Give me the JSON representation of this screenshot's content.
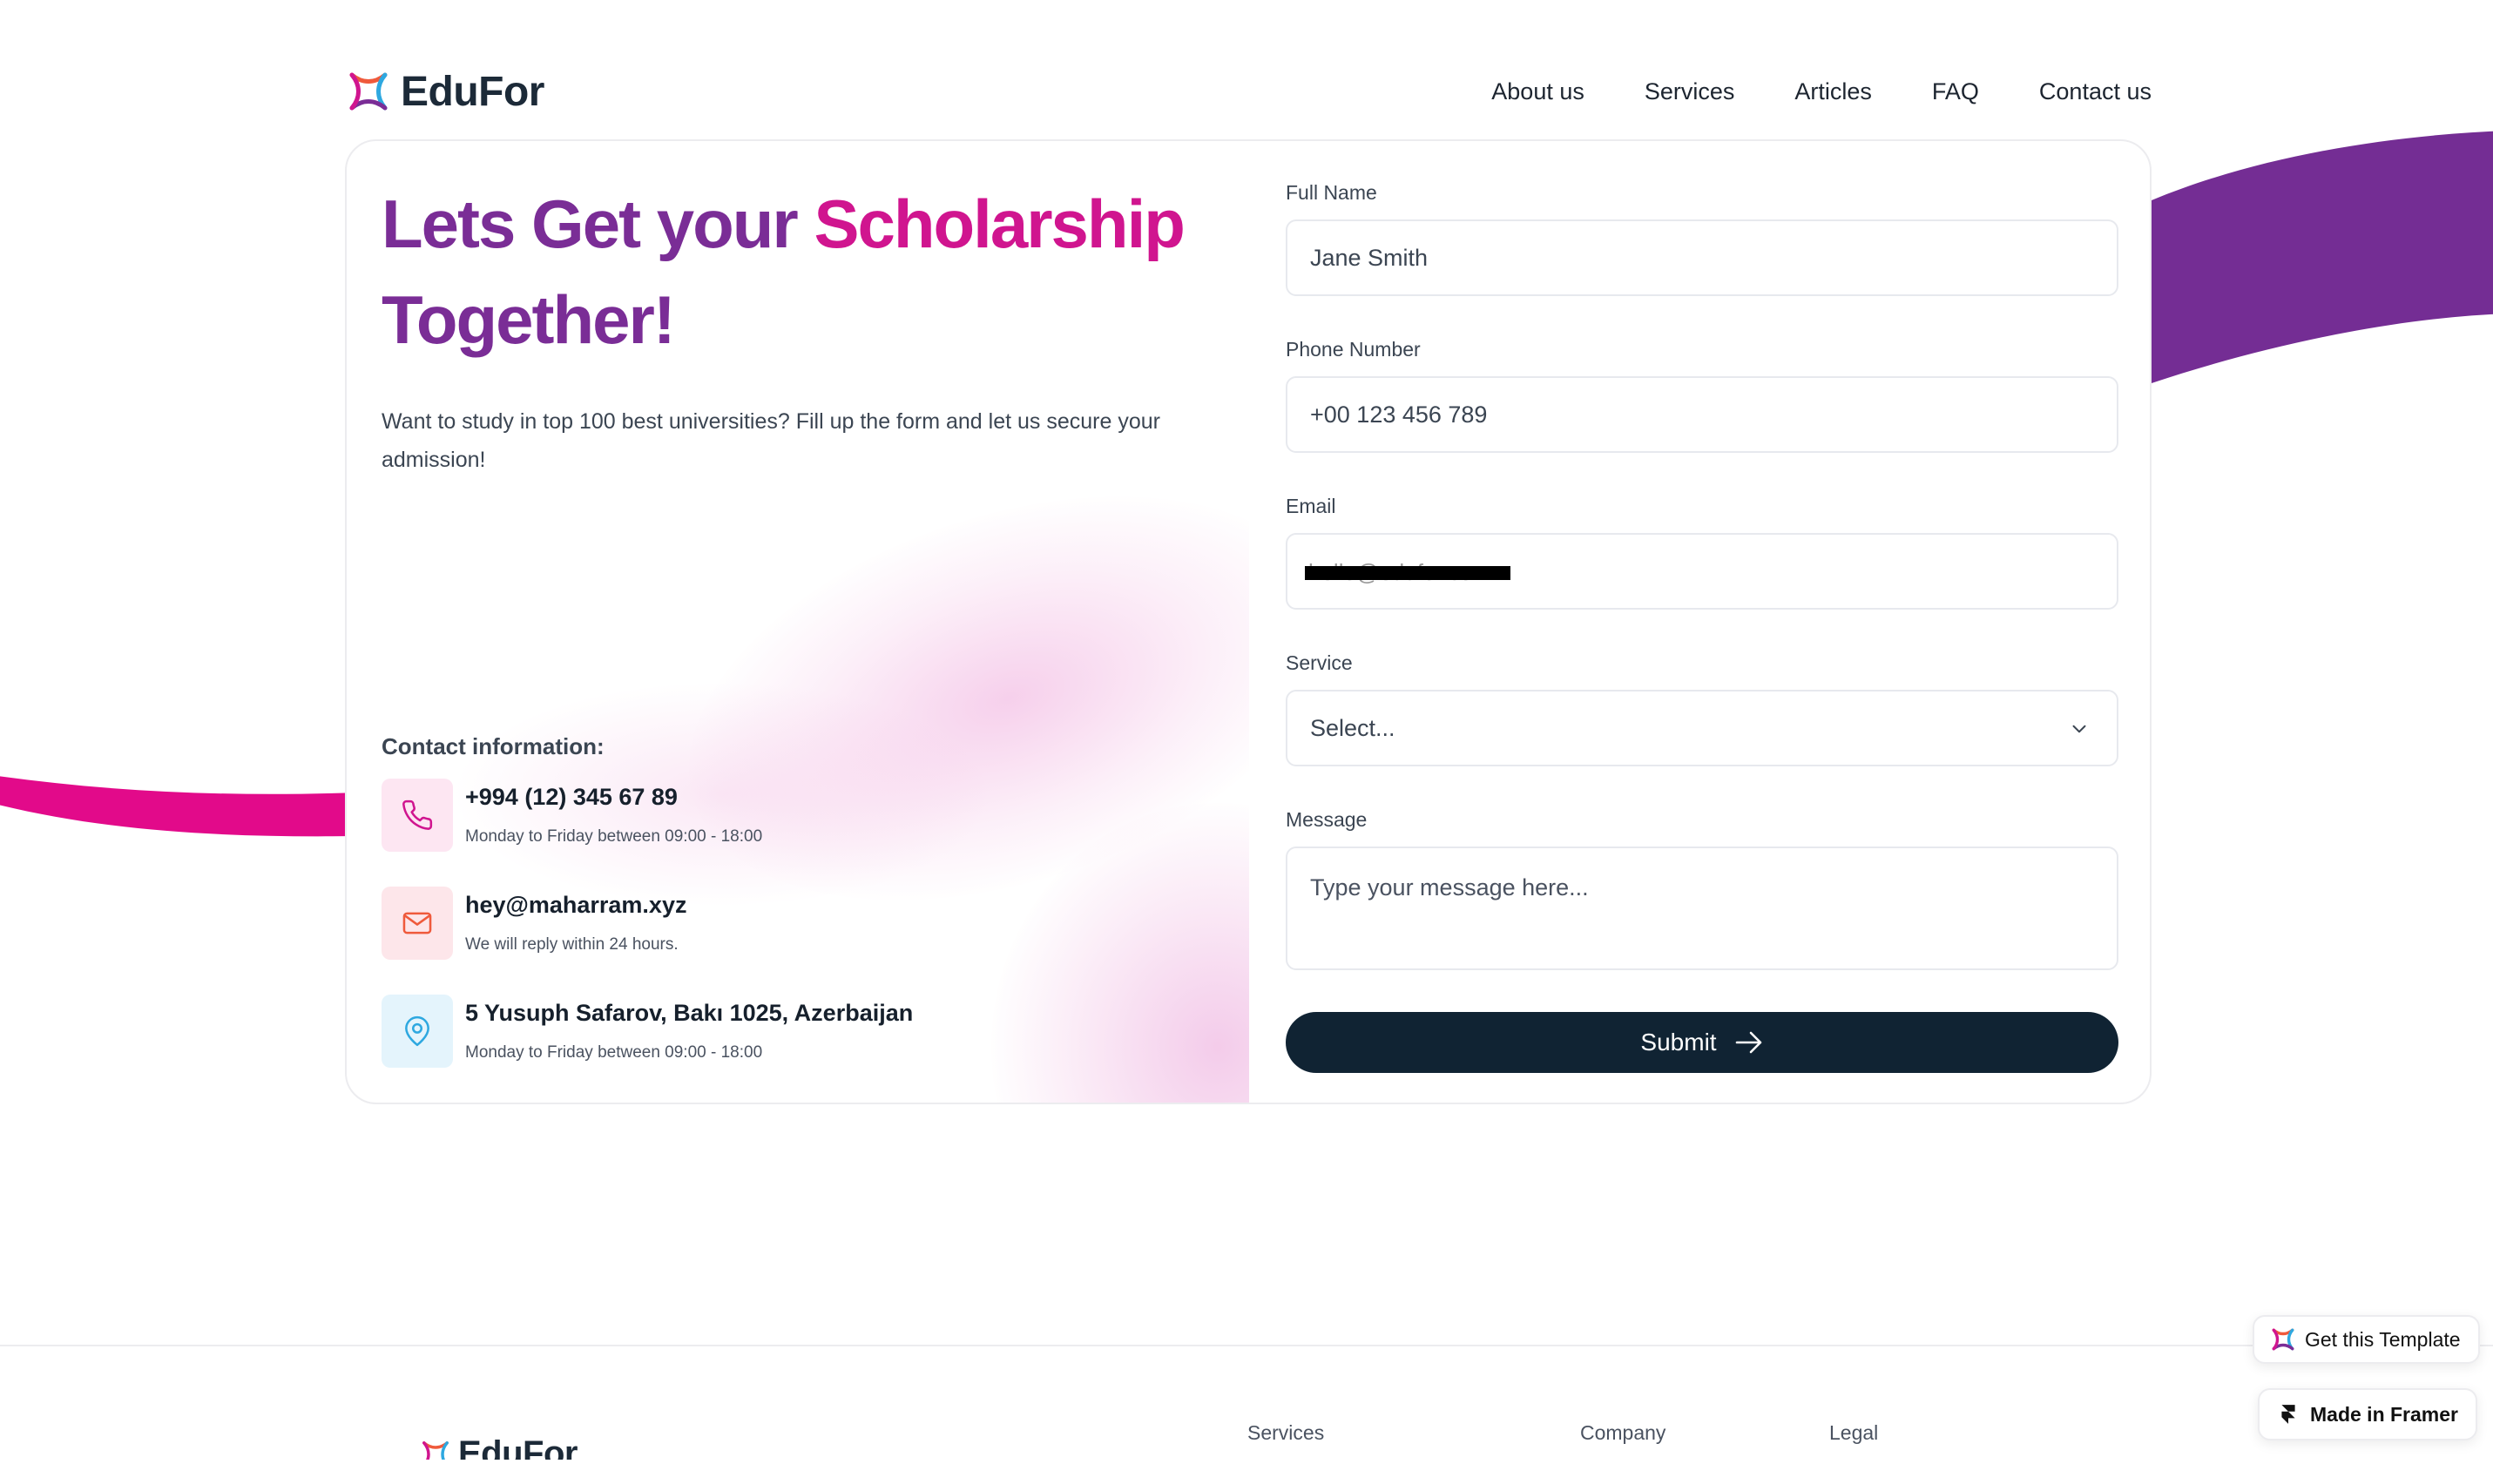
{
  "brand": {
    "name": "EduFor"
  },
  "nav": {
    "items": [
      {
        "label": "About us"
      },
      {
        "label": "Services"
      },
      {
        "label": "Articles"
      },
      {
        "label": "FAQ"
      },
      {
        "label": "Contact us"
      }
    ]
  },
  "hero": {
    "title_part1": "Lets Get your ",
    "title_part2": "Scholarship",
    "title_part3": "Together!",
    "subtitle": "Want to study in top 100 best universities? Fill up the form and let us secure your admission!"
  },
  "contact": {
    "heading": "Contact information:",
    "items": [
      {
        "icon": "phone-icon",
        "main": "+994 (12) 345 67 89",
        "sub": "Monday to Friday between 09:00 - 18:00",
        "icon_color": "#d0158f",
        "bg": "#fde6f2"
      },
      {
        "icon": "mail-icon",
        "main": "hey@maharram.xyz",
        "sub": "We will reply within 24 hours.",
        "icon_color": "#ef5a3c",
        "bg": "#fde6ea"
      },
      {
        "icon": "location-pin-icon",
        "main": "5 Yusuph Safarov, Bakı 1025, Azerbaijan",
        "sub": "Monday to Friday between 09:00 - 18:00",
        "icon_color": "#2ea8e0",
        "bg": "#e4f4fc"
      }
    ]
  },
  "form": {
    "full_name": {
      "label": "Full Name",
      "placeholder": "Jane Smith"
    },
    "phone": {
      "label": "Phone Number",
      "placeholder": "+00 123 456 789"
    },
    "email": {
      "label": "Email",
      "placeholder": "hello@edufor.com"
    },
    "service": {
      "label": "Service",
      "selected": "Select..."
    },
    "message": {
      "label": "Message",
      "placeholder": "Type your message here..."
    },
    "submit_label": "Submit"
  },
  "footer": {
    "brand": "EduFor",
    "columns": [
      {
        "title": "Services"
      },
      {
        "title": "Company"
      },
      {
        "title": "Legal"
      }
    ]
  },
  "badges": {
    "get_template": "Get this Template",
    "made_in": "Made in Framer"
  },
  "colors": {
    "purple": "#7a2d96",
    "magenta": "#d0158f",
    "button_dark": "#102333"
  }
}
